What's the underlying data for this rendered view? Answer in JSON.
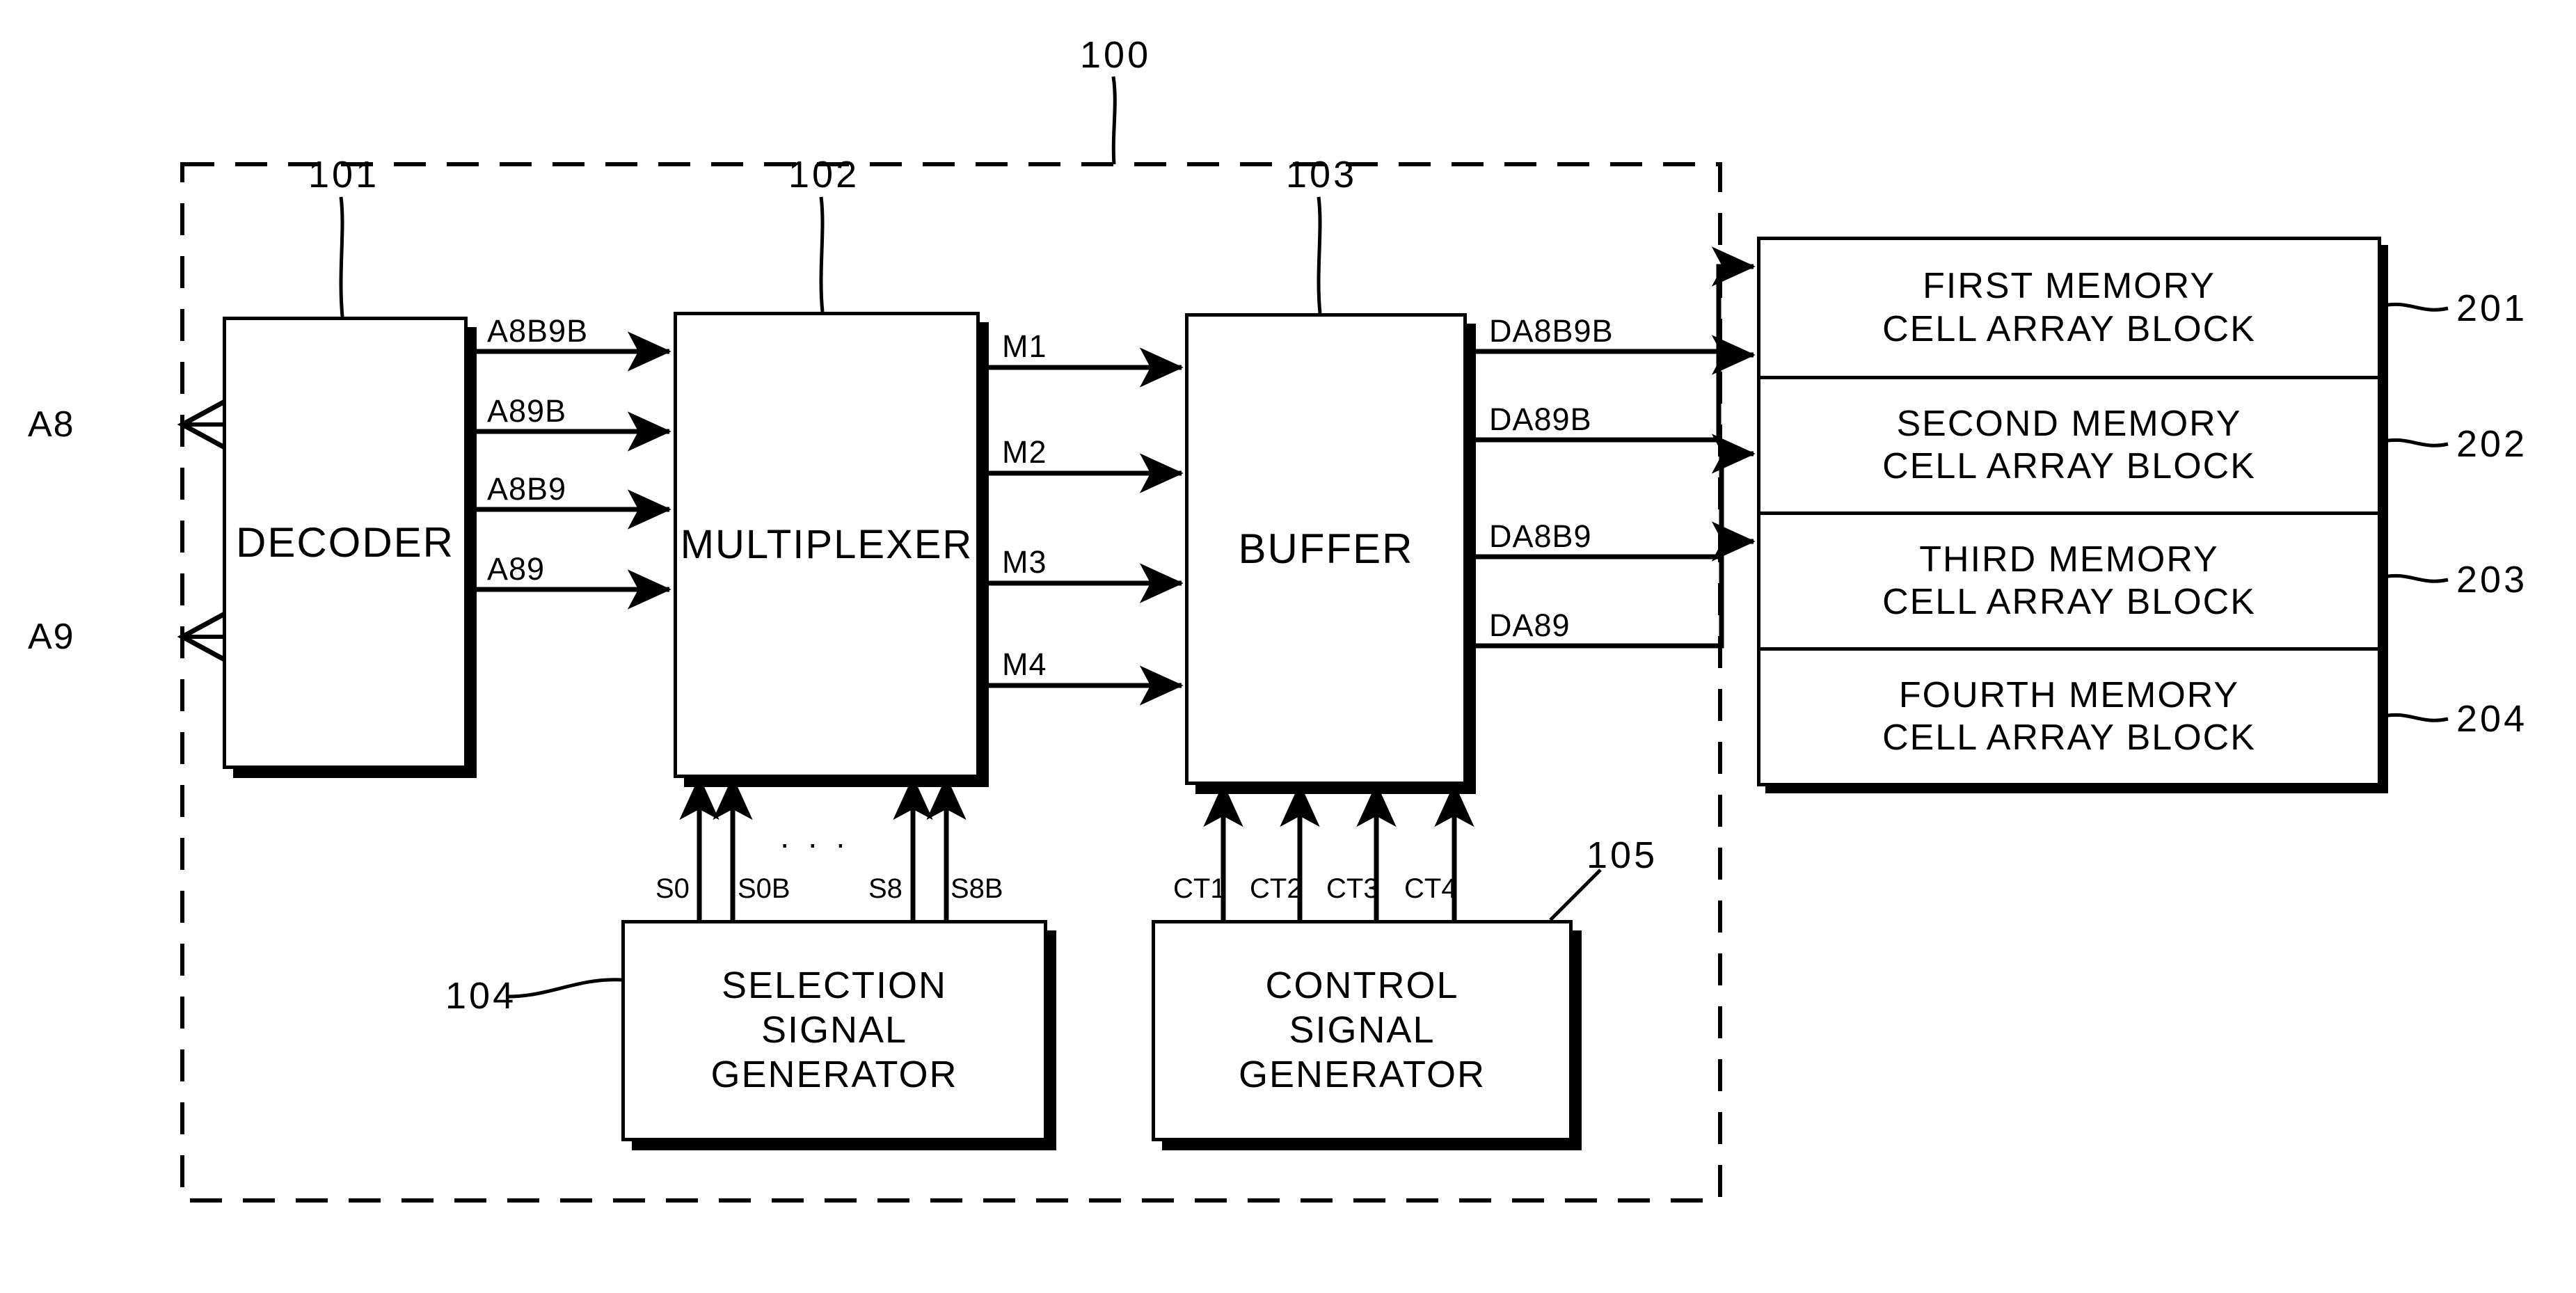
{
  "figure": {
    "type": "block-diagram",
    "system_ref": "100",
    "dashed_boundary": true
  },
  "inputs": [
    {
      "name": "A8",
      "label": "A8"
    },
    {
      "name": "A9",
      "label": "A9"
    }
  ],
  "blocks": [
    {
      "id": "decoder",
      "label": "DECODER",
      "ref": "101"
    },
    {
      "id": "mux",
      "label": "MULTIPLEXER",
      "ref": "102"
    },
    {
      "id": "buffer",
      "label": "BUFFER",
      "ref": "103"
    },
    {
      "id": "selgen",
      "label_lines": [
        "SELECTION",
        "SIGNAL",
        "GENERATOR"
      ],
      "ref": "104"
    },
    {
      "id": "ctrlgen",
      "label_lines": [
        "CONTROL",
        "SIGNAL",
        "GENERATOR"
      ],
      "ref": "105"
    }
  ],
  "memory_blocks": [
    {
      "label_lines": [
        "FIRST MEMORY",
        "CELL ARRAY BLOCK"
      ],
      "ref": "201"
    },
    {
      "label_lines": [
        "SECOND MEMORY",
        "CELL ARRAY BLOCK"
      ],
      "ref": "202"
    },
    {
      "label_lines": [
        "THIRD MEMORY",
        "CELL ARRAY BLOCK"
      ],
      "ref": "203"
    },
    {
      "label_lines": [
        "FOURTH MEMORY",
        "CELL ARRAY BLOCK"
      ],
      "ref": "204"
    }
  ],
  "decoder_outputs": [
    {
      "label": "A8B9B"
    },
    {
      "label": "A89B"
    },
    {
      "label": "A8B9"
    },
    {
      "label": "A89"
    }
  ],
  "mux_outputs": [
    {
      "label": "M1"
    },
    {
      "label": "M2"
    },
    {
      "label": "M3"
    },
    {
      "label": "M4"
    }
  ],
  "buffer_outputs": [
    {
      "label": "DA8B9B"
    },
    {
      "label": "DA89B"
    },
    {
      "label": "DA8B9"
    },
    {
      "label": "DA89"
    }
  ],
  "selection_signals": [
    {
      "label": "S0"
    },
    {
      "label": "S0B"
    },
    {
      "label": "S8"
    },
    {
      "label": "S8B"
    }
  ],
  "selection_ellipsis": "·  ·  ·",
  "control_signals": [
    {
      "label": "CT1"
    },
    {
      "label": "CT2"
    },
    {
      "label": "CT3"
    },
    {
      "label": "CT4"
    }
  ],
  "refs": {
    "system": "100",
    "decoder": "101",
    "mux": "102",
    "buffer": "103",
    "selgen": "104",
    "ctrlgen": "105",
    "mem1": "201",
    "mem2": "202",
    "mem3": "203",
    "mem4": "204"
  },
  "colors": {
    "stroke": "#000000",
    "background": "#ffffff"
  }
}
